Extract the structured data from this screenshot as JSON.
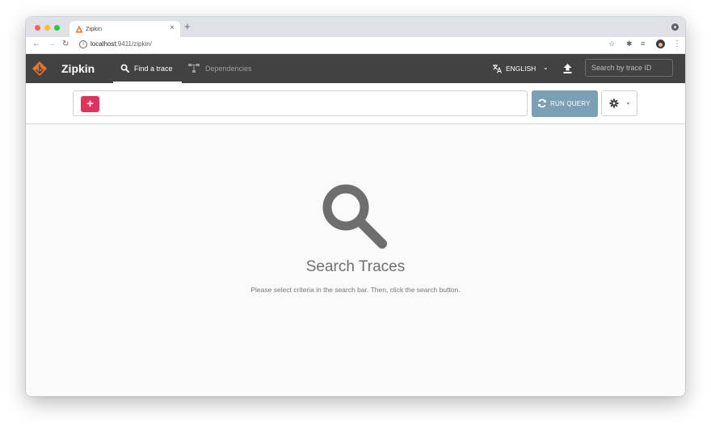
{
  "browser": {
    "tab_title": "Zipkin",
    "tab_close": "×",
    "new_tab": "+",
    "url_host": "localhost",
    "url_path": ":9411/zipkin/"
  },
  "app": {
    "brand": "Zipkin",
    "nav": {
      "find_trace": "Find a trace",
      "dependencies": "Dependencies"
    },
    "language": "ENGLISH",
    "trace_search_placeholder": "Search by trace ID"
  },
  "search_bar": {
    "add_label": "+",
    "run_query_label": "RUN QUERY"
  },
  "empty_state": {
    "title": "Search Traces",
    "subtitle": "Please select criteria in the search bar. Then, click the search button."
  },
  "colors": {
    "appbar": "#424242",
    "logo": "#e4772f",
    "add_button": "#e0325c",
    "run_button": "#7ba0b5",
    "empty_icon": "#6e6e6e"
  }
}
